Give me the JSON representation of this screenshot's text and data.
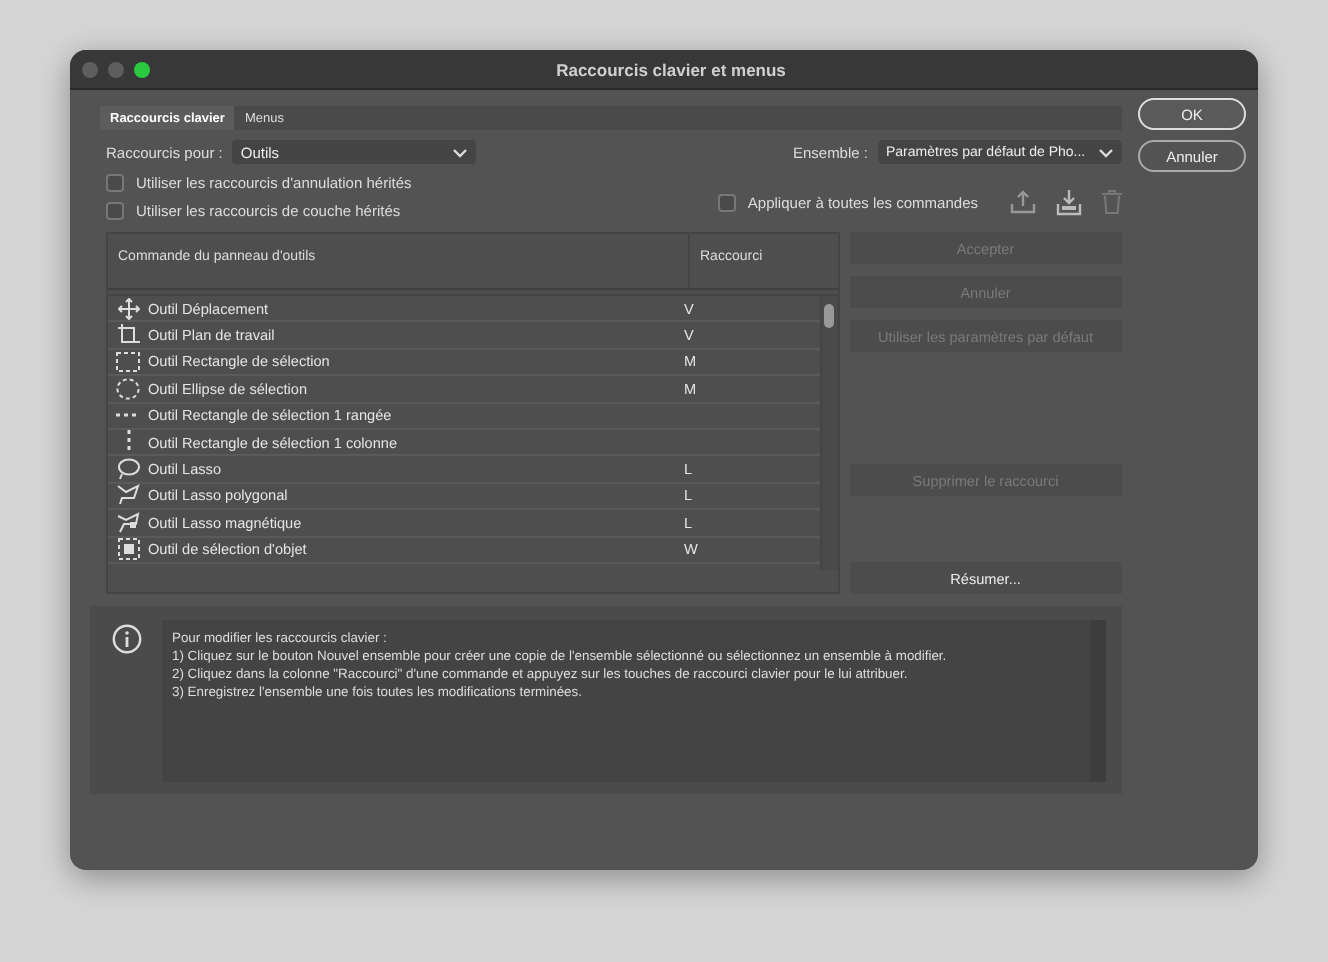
{
  "window": {
    "title": "Raccourcis clavier et menus"
  },
  "tabs": [
    {
      "label": "Raccourcis clavier",
      "selected": true
    },
    {
      "label": "Menus",
      "selected": false
    }
  ],
  "shortcuts_for": {
    "label": "Raccourcis pour :",
    "value": "Outils"
  },
  "set": {
    "label": "Ensemble :",
    "value": "Paramètres par défaut de Pho..."
  },
  "options": [
    {
      "label": "Utiliser les raccourcis d'annulation hérités",
      "checked": false
    },
    {
      "label": "Utiliser les raccourcis de couche hérités",
      "checked": false
    }
  ],
  "apply_all": {
    "label": "Appliquer à toutes les commandes",
    "checked": false
  },
  "table": {
    "columns": [
      "Commande du panneau d'outils",
      "Raccourci"
    ],
    "rows": [
      {
        "kind": "move",
        "command": "Outil Déplacement",
        "shortcut": "V"
      },
      {
        "kind": "artboard",
        "command": "Outil Plan de travail",
        "shortcut": "V"
      },
      {
        "kind": "rect",
        "command": "Outil Rectangle de sélection",
        "shortcut": "M"
      },
      {
        "kind": "ellipse",
        "command": "Outil Ellipse de sélection",
        "shortcut": "M"
      },
      {
        "kind": "row",
        "command": "Outil Rectangle de sélection 1 rangée",
        "shortcut": ""
      },
      {
        "kind": "column",
        "command": "Outil Rectangle de sélection 1 colonne",
        "shortcut": ""
      },
      {
        "kind": "lasso",
        "command": "Outil Lasso",
        "shortcut": "L"
      },
      {
        "kind": "polygon",
        "command": "Outil Lasso polygonal",
        "shortcut": "L"
      },
      {
        "kind": "magnetic",
        "command": "Outil Lasso magnétique",
        "shortcut": "L"
      },
      {
        "kind": "object",
        "command": "Outil de sélection d'objet",
        "shortcut": "W"
      }
    ]
  },
  "side_buttons": [
    {
      "label": "Accepter",
      "disabled": true
    },
    {
      "label": "Annuler",
      "disabled": true
    },
    {
      "label": "Utiliser les paramètres par défaut",
      "disabled": true
    },
    {
      "label": "Supprimer le raccourci",
      "disabled": true
    },
    {
      "label": "Résumer...",
      "disabled": false
    }
  ],
  "dialog_buttons": [
    {
      "label": "OK",
      "selected": true
    },
    {
      "label": "Annuler",
      "selected": false
    }
  ],
  "info": {
    "lines": [
      "Pour modifier les raccourcis clavier :",
      "1) Cliquez sur le bouton Nouvel ensemble pour créer une copie de l'ensemble sélectionné ou sélectionnez un ensemble à modifier.",
      "2) Cliquez dans la colonne \"Raccourci\" d'une commande et appuyez sur les touches de raccourci clavier pour le lui attribuer.",
      "3) Enregistrez l'ensemble une fois toutes les modifications terminées."
    ]
  }
}
